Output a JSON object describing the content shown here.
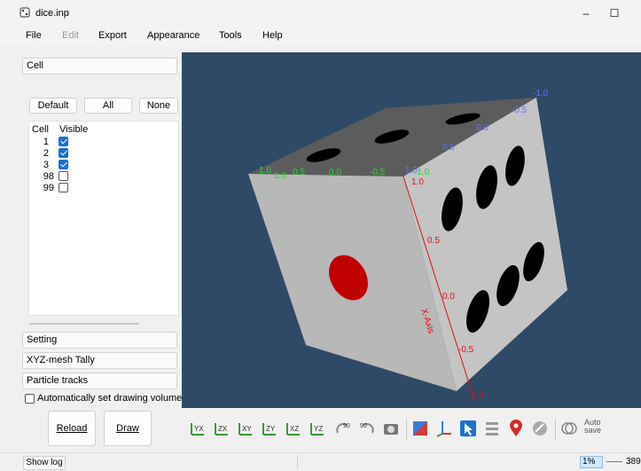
{
  "window": {
    "title": "dice.inp",
    "minimize": "–",
    "maximize": "☐"
  },
  "menu": {
    "items": [
      {
        "label": "File",
        "enabled": true
      },
      {
        "label": "Edit",
        "enabled": false
      },
      {
        "label": "Export",
        "enabled": true
      },
      {
        "label": "Appearance",
        "enabled": true
      },
      {
        "label": "Tools",
        "enabled": true
      },
      {
        "label": "Help",
        "enabled": true
      }
    ]
  },
  "left": {
    "cell_section": "Cell",
    "buttons": {
      "default": "Default",
      "all": "All",
      "none": "None"
    },
    "cell_table": {
      "headers": [
        "Cell",
        "Visible"
      ],
      "rows": [
        {
          "cell": "1",
          "visible": true
        },
        {
          "cell": "2",
          "visible": true
        },
        {
          "cell": "3",
          "visible": true
        },
        {
          "cell": "98",
          "visible": false
        },
        {
          "cell": "99",
          "visible": false
        }
      ]
    },
    "setting_section": "Setting",
    "xyz_section": "XYZ-mesh Tally",
    "tracks_section": "Particle tracks",
    "auto_volume_label": "Automatically set drawing volume",
    "reload_label": "Reload",
    "draw_label": "Draw"
  },
  "viewport": {
    "background": "#2e4a66",
    "axis_labels": {
      "top_blue": [
        "-1.0",
        "-0.5",
        "0.0",
        "0.5",
        "1.0"
      ],
      "top_green": [
        "1.0",
        "1.0",
        "0.5",
        "0.0",
        "-0.5",
        "-1.0"
      ],
      "red": [
        "1.0",
        "0.5",
        "0.0",
        "-0.5",
        "-1.0"
      ],
      "x_axis_title": "X-Axis"
    },
    "colors": {
      "blue_axis": "#6b6bff",
      "green_axis": "#22dd22",
      "red_axis": "#e01010",
      "pip_red": "#cc0000"
    }
  },
  "toolbar": {
    "icons": [
      "view-yx-icon",
      "view-zx-icon",
      "view-xy-icon",
      "view-zy-icon",
      "view-xz-icon",
      "view-yz-icon",
      "rotate-ccw-90-icon",
      "rotate-cw-90-icon",
      "camera-icon",
      "color-cube-icon",
      "axes-icon",
      "pointer-icon",
      "list-icon",
      "location-pin-icon",
      "eraser-icon",
      "venn-icon",
      "autosave-icon"
    ],
    "rotate_ccw_label": "90",
    "rotate_cw_label": "90",
    "autosave_label_1": "Auto",
    "autosave_label_2": "save"
  },
  "status": {
    "show_log": "Show log",
    "percent": "1%",
    "number": "389"
  }
}
